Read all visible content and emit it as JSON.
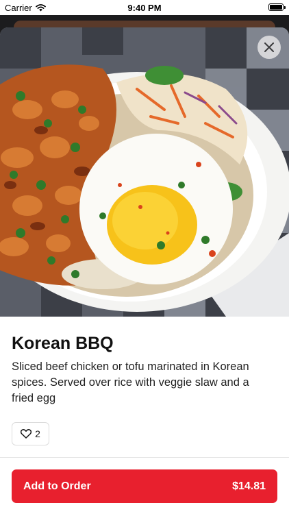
{
  "status_bar": {
    "carrier": "Carrier",
    "time": "9:40 PM"
  },
  "item": {
    "name": "Korean BBQ",
    "description": "Sliced beef chicken or tofu marinated in Korean spices. Served over rice with veggie slaw and a fried egg",
    "likes": "2",
    "image_icon": "food-photo"
  },
  "order": {
    "add_label": "Add to Order",
    "price": "$14.81"
  },
  "colors": {
    "accent": "#e8202e"
  }
}
